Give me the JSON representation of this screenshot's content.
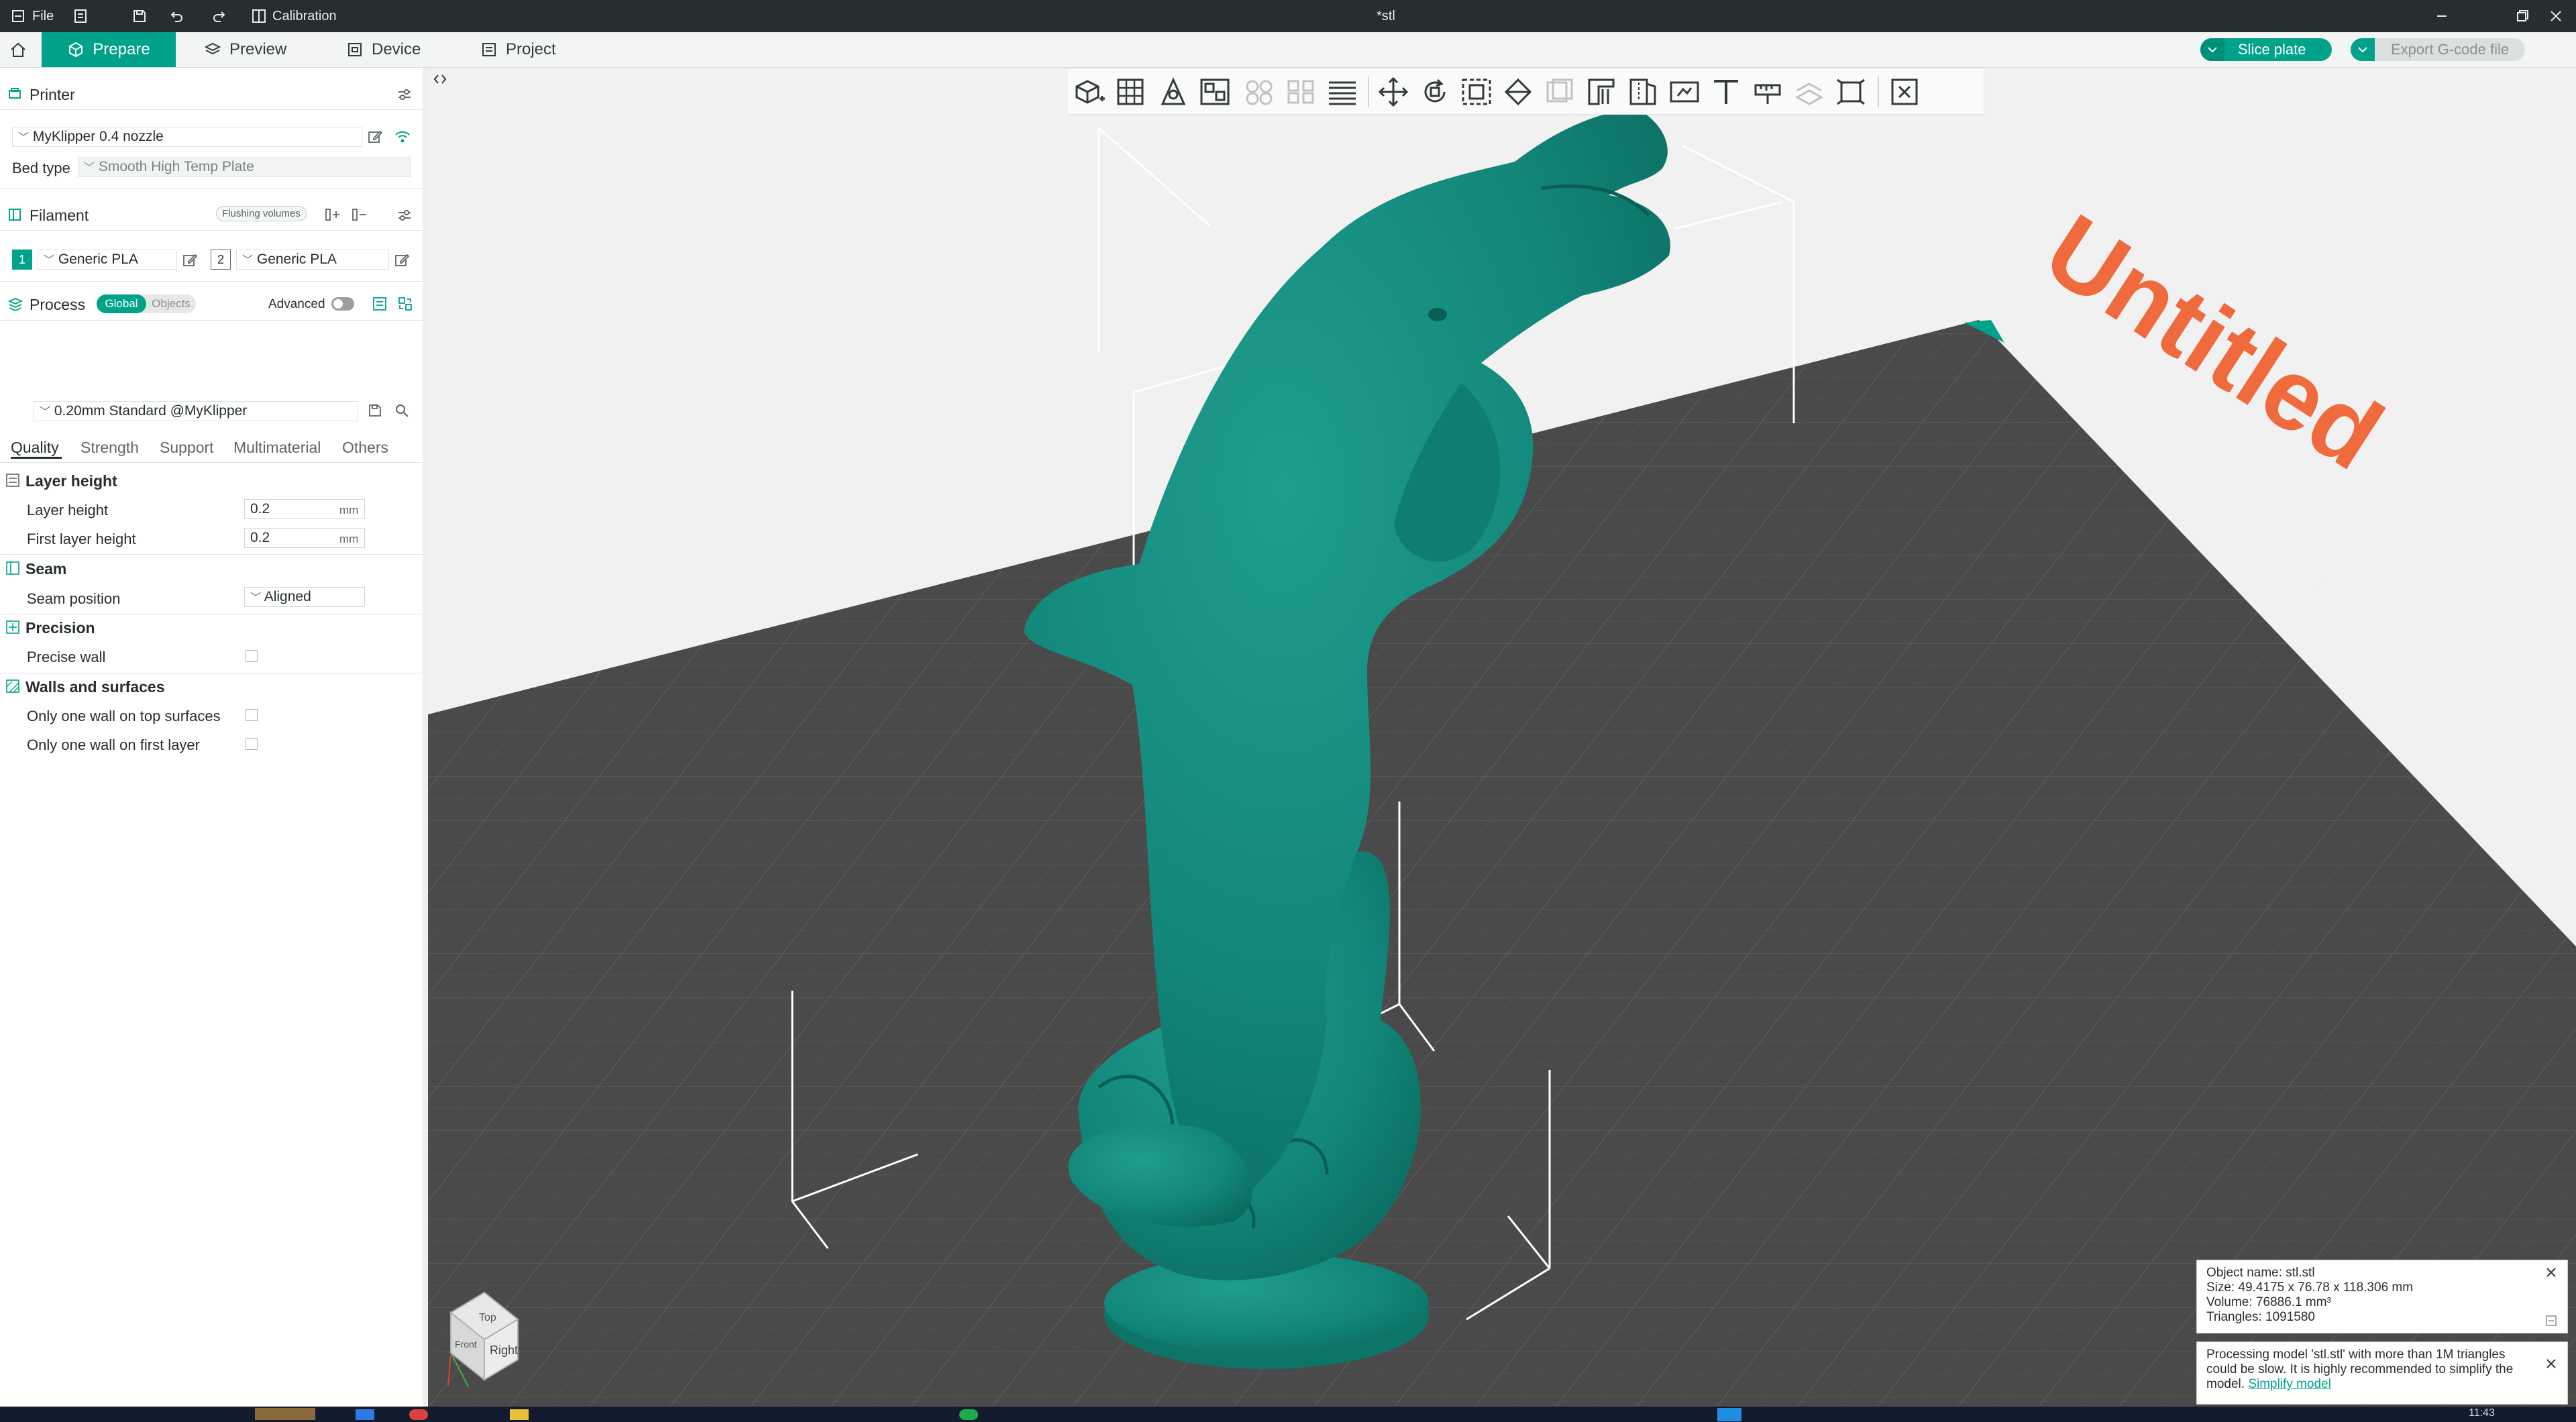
{
  "titlebar": {
    "menu_file": "File",
    "calibration": "Calibration",
    "document_title": "*stl"
  },
  "topbar": {
    "tabs": [
      {
        "label": "Prepare",
        "active": true
      },
      {
        "label": "Preview",
        "active": false
      },
      {
        "label": "Device",
        "active": false
      },
      {
        "label": "Project",
        "active": false
      }
    ],
    "slice_label": "Slice plate",
    "export_label": "Export G-code file"
  },
  "printer": {
    "section_title": "Printer",
    "printer_name": "MyKlipper 0.4 nozzle",
    "bed_type_label": "Bed type",
    "bed_type_value": "Smooth High Temp Plate"
  },
  "filament": {
    "section_title": "Filament",
    "flushing_label": "Flushing volumes",
    "slots": [
      {
        "number": "1",
        "name": "Generic PLA",
        "color": "#00a38a"
      },
      {
        "number": "2",
        "name": "Generic PLA",
        "color": "#ffffff"
      }
    ]
  },
  "process": {
    "section_title": "Process",
    "global_label": "Global",
    "objects_label": "Objects",
    "advanced_label": "Advanced",
    "advanced_on": false,
    "preset": "0.20mm Standard @MyKlipper",
    "tabs": [
      "Quality",
      "Strength",
      "Support",
      "Multimaterial",
      "Others"
    ],
    "active_tab": "Quality",
    "groups": {
      "layer_height_title": "Layer height",
      "layer_height_label": "Layer height",
      "layer_height_value": "0.2",
      "first_layer_height_label": "First layer height",
      "first_layer_height_value": "0.2",
      "unit_mm": "mm",
      "seam_title": "Seam",
      "seam_position_label": "Seam position",
      "seam_position_value": "Aligned",
      "precision_title": "Precision",
      "precise_wall_label": "Precise wall",
      "precise_wall_checked": false,
      "walls_title": "Walls and surfaces",
      "one_wall_top_label": "Only one wall on top surfaces",
      "one_wall_top_checked": false,
      "one_wall_first_label": "Only one wall on first layer",
      "one_wall_first_checked": false
    }
  },
  "viewport": {
    "plate_label": "Untitled",
    "view_cube": {
      "top": "Top",
      "front": "Front",
      "right": "Right"
    },
    "model_color": "#12877a",
    "accent_color": "#00a38a",
    "plate_text_color": "#ef6a3c"
  },
  "object_info": {
    "name_line": "Object name: stl.stl",
    "size_line": "Size: 49.4175 x 76.78 x 118.306 mm",
    "volume_line": "Volume: 76886.1 mm³",
    "triangles_line": "Triangles: 1091580"
  },
  "notification": {
    "message": "Processing model 'stl.stl' with more than 1M triangles could be slow. It is highly recommended to simplify the model.",
    "link": "Simplify model"
  },
  "taskbar": {
    "clock": "11:43"
  }
}
